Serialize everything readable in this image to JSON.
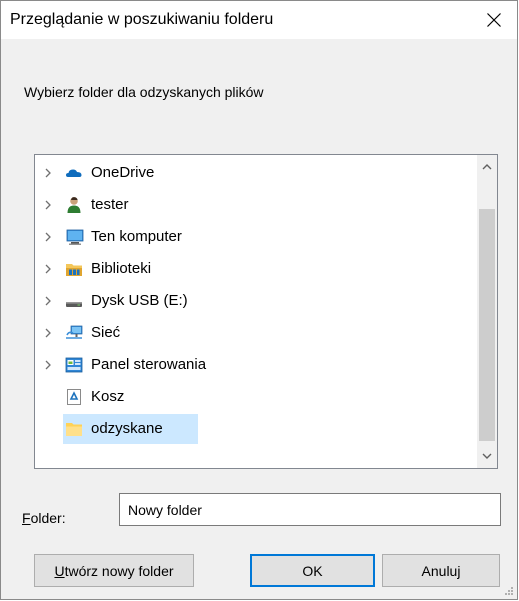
{
  "dialog": {
    "title": "Przeglądanie w poszukiwaniu folderu",
    "prompt": "Wybierz folder dla odzyskanych plików"
  },
  "tree": {
    "items": [
      {
        "label": "OneDrive",
        "icon": "onedrive-cloud-icon",
        "expandable": true
      },
      {
        "label": "tester",
        "icon": "user-icon",
        "expandable": true
      },
      {
        "label": "Ten komputer",
        "icon": "computer-monitor-icon",
        "expandable": true
      },
      {
        "label": "Biblioteki",
        "icon": "libraries-icon",
        "expandable": true
      },
      {
        "label": "Dysk USB (E:)",
        "icon": "usb-drive-icon",
        "expandable": true
      },
      {
        "label": "Sieć",
        "icon": "network-icon",
        "expandable": true
      },
      {
        "label": "Panel sterowania",
        "icon": "control-panel-icon",
        "expandable": true
      },
      {
        "label": "Kosz",
        "icon": "recycle-bin-icon",
        "expandable": false
      },
      {
        "label": "odzyskane",
        "icon": "folder-icon",
        "expandable": false,
        "selected": true
      }
    ]
  },
  "folder": {
    "label_accel": "F",
    "label_rest": "older:",
    "value": "Nowy folder"
  },
  "buttons": {
    "new_folder_accel": "U",
    "new_folder_rest": "twórz nowy folder",
    "ok": "OK",
    "cancel": "Anuluj"
  },
  "colors": {
    "selection": "#cce8ff",
    "accent": "#0078d7"
  }
}
